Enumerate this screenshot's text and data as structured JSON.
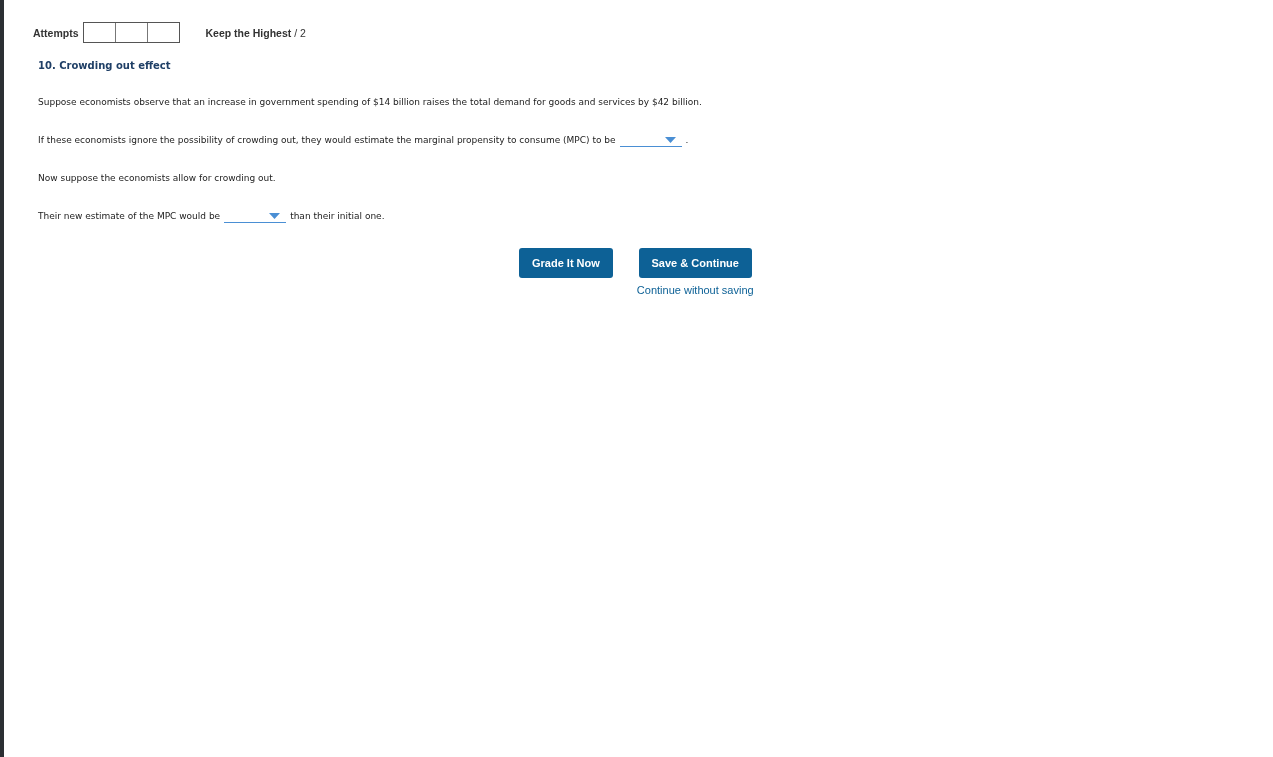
{
  "attempts": {
    "label": "Attempts",
    "policy": "Keep the Highest",
    "separator": "/",
    "max": "2"
  },
  "question": {
    "title": "10. Crowding out effect",
    "paragraphs": [
      [
        {
          "kind": "text",
          "text": "Suppose economists observe that an increase in government spending of $14 billion raises the total demand for goods and services by $42 billion."
        }
      ],
      [
        {
          "kind": "text",
          "text": "If these economists ignore the possibility of crowding out, they would estimate the marginal propensity to consume (MPC) to be"
        },
        {
          "kind": "dropdown"
        },
        {
          "kind": "text",
          "text": "."
        }
      ],
      [
        {
          "kind": "text",
          "text": "Now suppose the economists allow for crowding out."
        }
      ],
      [
        {
          "kind": "text",
          "text": "Their new estimate of the MPC would be"
        },
        {
          "kind": "dropdown"
        },
        {
          "kind": "text",
          "text": "than their initial one."
        }
      ]
    ]
  },
  "buttons": [
    "Grade It Now",
    "Save & Continue"
  ],
  "link": "Continue without saving"
}
